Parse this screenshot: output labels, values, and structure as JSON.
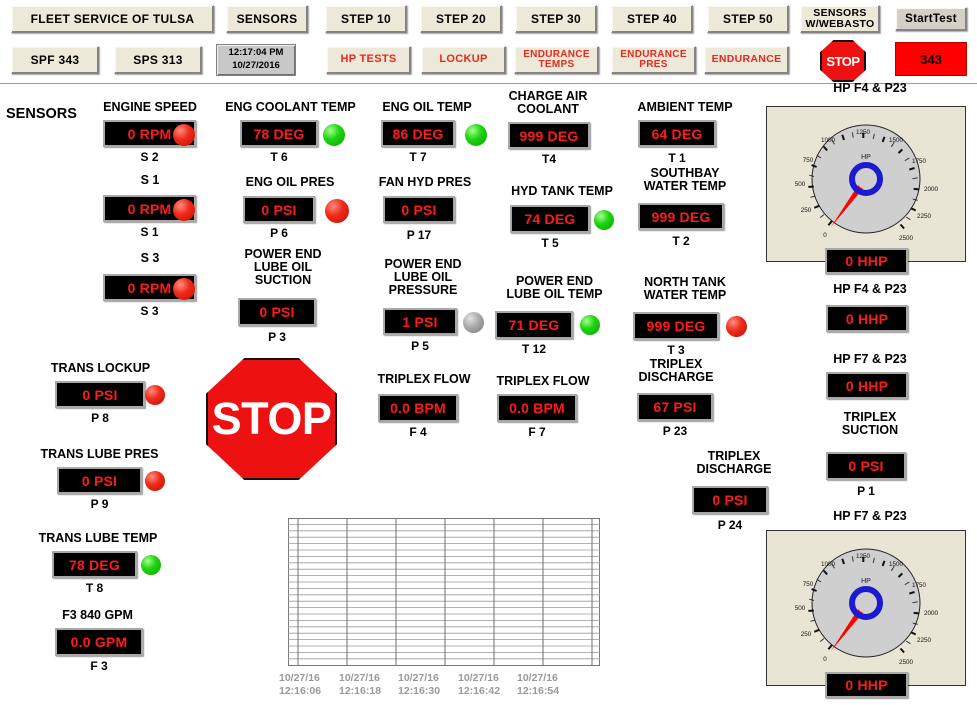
{
  "toolbar": {
    "row1": [
      {
        "label": "FLEET SERVICE OF TULSA",
        "style": "plain"
      },
      {
        "label": "SENSORS",
        "style": "plain"
      },
      {
        "label": "STEP 10",
        "style": "plain"
      },
      {
        "label": "STEP 20",
        "style": "plain"
      },
      {
        "label": "STEP 30",
        "style": "plain"
      },
      {
        "label": "STEP 40",
        "style": "plain"
      },
      {
        "label": "STEP 50",
        "style": "plain"
      },
      {
        "label": "SENSORS\nW/WEBASTO",
        "style": "plain-small"
      },
      {
        "label": "StartTest",
        "style": "gray"
      }
    ],
    "row2": [
      {
        "label": "SPF 343",
        "style": "plain"
      },
      {
        "label": "SPS 313",
        "style": "plain"
      },
      {
        "label": "HP TESTS",
        "style": "red"
      },
      {
        "label": "LOCKUP",
        "style": "red"
      },
      {
        "label": "ENDURANCE\nTEMPS",
        "style": "red"
      },
      {
        "label": "ENDURANCE\nPRES",
        "style": "red"
      },
      {
        "label": "ENDURANCE",
        "style": "red"
      }
    ],
    "clock": {
      "time": "12:17:04 PM",
      "date": "10/27/2016"
    },
    "stop_button_label": "STOP",
    "test_number": "343"
  },
  "section_title": "SENSORS",
  "sensors": [
    {
      "id": "engine-speed-s2",
      "label": "ENGINE SPEED",
      "value": "0 RPM",
      "tag": "S 2",
      "lamp": "red"
    },
    {
      "id": "engine-speed-s1",
      "label": "S 1",
      "value": "0 RPM",
      "tag": "S 1",
      "lamp": "red"
    },
    {
      "id": "engine-speed-s3",
      "label": "S 3",
      "value": "0 RPM",
      "tag": "S 3",
      "lamp": "red"
    },
    {
      "id": "trans-lockup",
      "label": "TRANS LOCKUP",
      "value": "0 PSI",
      "tag": "P 8",
      "lamp": "red"
    },
    {
      "id": "trans-lube-pres",
      "label": "TRANS LUBE PRES",
      "value": "0 PSI",
      "tag": "P 9",
      "lamp": "red"
    },
    {
      "id": "trans-lube-temp",
      "label": "TRANS LUBE TEMP",
      "value": "78 DEG",
      "tag": "T 8",
      "lamp": "green"
    },
    {
      "id": "f3-840-gpm",
      "label": "F3 840 GPM",
      "value": "0.0 GPM",
      "tag": "F 3",
      "lamp": "none"
    },
    {
      "id": "eng-coolant-temp",
      "label": "ENG COOLANT TEMP",
      "value": "78 DEG",
      "tag": "T 6",
      "lamp": "green"
    },
    {
      "id": "eng-oil-pres",
      "label": "ENG OIL PRES",
      "value": "0 PSI",
      "tag": "P 6",
      "lamp": "red"
    },
    {
      "id": "pe-lube-oil-suction",
      "label": "POWER END\nLUBE OIL\nSUCTION",
      "value": "0 PSI",
      "tag": "P 3",
      "lamp": "none"
    },
    {
      "id": "eng-oil-temp",
      "label": "ENG OIL TEMP",
      "value": "86 DEG",
      "tag": "T 7",
      "lamp": "green"
    },
    {
      "id": "fan-hyd-pres",
      "label": "FAN HYD PRES",
      "value": "0 PSI",
      "tag": "P 17",
      "lamp": "none"
    },
    {
      "id": "pe-lube-oil-pressure",
      "label": "POWER END\nLUBE OIL\nPRESSURE",
      "value": "1 PSI",
      "tag": "P 5",
      "lamp": "gray"
    },
    {
      "id": "triplex-flow-f4",
      "label": "TRIPLEX FLOW",
      "value": "0.0 BPM",
      "tag": "F 4",
      "lamp": "none"
    },
    {
      "id": "charge-air-coolant",
      "label": "CHARGE AIR\nCOOLANT",
      "value": "999 DEG",
      "tag": "T4",
      "lamp": "none"
    },
    {
      "id": "hyd-tank-temp",
      "label": "HYD TANK TEMP",
      "value": "74 DEG",
      "tag": "T 5",
      "lamp": "green"
    },
    {
      "id": "pe-lube-oil-temp",
      "label": "POWER END\nLUBE OIL TEMP",
      "value": "71 DEG",
      "tag": "T 12",
      "lamp": "green"
    },
    {
      "id": "triplex-flow-f7",
      "label": "TRIPLEX FLOW",
      "value": "0.0 BPM",
      "tag": "F 7",
      "lamp": "none"
    },
    {
      "id": "ambient-temp",
      "label": "AMBIENT TEMP",
      "value": "64 DEG",
      "tag": "T 1",
      "lamp": "none"
    },
    {
      "id": "southbay-water-temp",
      "label": "SOUTHBAY\nWATER TEMP",
      "value": "999 DEG",
      "tag": "T 2",
      "lamp": "none"
    },
    {
      "id": "north-tank-water-temp",
      "label": "NORTH TANK\nWATER TEMP",
      "value": "999 DEG",
      "tag": "T 3",
      "lamp": "red"
    },
    {
      "id": "triplex-discharge-p23",
      "label": "TRIPLEX\nDISCHARGE",
      "value": "67 PSI",
      "tag": "P 23",
      "lamp": "none"
    },
    {
      "id": "triplex-discharge-p24",
      "label": "TRIPLEX\nDISCHARGE",
      "value": "0 PSI",
      "tag": "P 24",
      "lamp": "none"
    },
    {
      "id": "hp-f4-p23-readout",
      "label": "HP F4 & P23",
      "value": "0 HHP",
      "tag": "",
      "lamp": "none"
    },
    {
      "id": "hp-f7-p23-readout",
      "label": "HP F7 & P23",
      "value": "0 HHP",
      "tag": "",
      "lamp": "none"
    },
    {
      "id": "triplex-suction",
      "label": "TRIPLEX\nSUCTION",
      "value": "0 PSI",
      "tag": "P 1",
      "lamp": "none"
    }
  ],
  "gauges": [
    {
      "id": "hp-f4-p23-gauge",
      "title": "HP F4 & P23",
      "center_label": "HP",
      "readout": "0 HHP",
      "value": 0,
      "min": 0,
      "max": 2500,
      "ticks": [
        0,
        250,
        500,
        750,
        1000,
        1250,
        1500,
        1750,
        2000,
        2250,
        2500
      ],
      "needle_color": "#ff0000",
      "hub_color": "#1a1ad0",
      "face_color": "#cfcfcf"
    },
    {
      "id": "hp-f7-p23-gauge",
      "title": "HP F7 & P23",
      "center_label": "HP",
      "readout": "0 HHP",
      "value": 0,
      "min": 0,
      "max": 2500,
      "ticks": [
        0,
        250,
        500,
        750,
        1000,
        1250,
        1500,
        1750,
        2000,
        2250,
        2500
      ],
      "needle_color": "#ff0000",
      "hub_color": "#1a1ad0",
      "face_color": "#cfcfcf"
    }
  ],
  "chart_data": {
    "type": "line",
    "title": "",
    "xlabel": "",
    "ylabel": "",
    "grid": true,
    "legend": "none",
    "series": [],
    "x_tick_labels": [
      "10/27/16\n12:16:06",
      "10/27/16\n12:16:18",
      "10/27/16\n12:16:30",
      "10/27/16\n12:16:42",
      "10/27/16\n12:16:54"
    ],
    "x_gridlines": 7,
    "y_gridlines": 23,
    "note": "Empty trend chart - no plotted data series visible"
  },
  "stop_sign": {
    "label": "STOP"
  },
  "colors": {
    "readout_text": "#ff1a1a",
    "readout_bg": "#000000",
    "alarm_red": "#f02b18",
    "ok_green": "#1fd411",
    "panel_bg": "#e8e5d5",
    "button_bg": "#ece9d8",
    "red_accent": "#e8281e"
  }
}
